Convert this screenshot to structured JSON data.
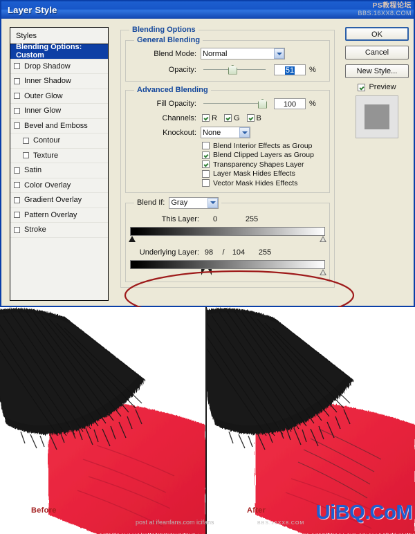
{
  "window": {
    "title": "Layer Style",
    "watermark_line1": "PS教程论坛",
    "watermark_line2": "BBS.16XX8.COM"
  },
  "sidebar": {
    "header": "Styles",
    "items": [
      {
        "label": "Blending Options: Custom",
        "selected": true,
        "checkbox": false,
        "indent": false
      },
      {
        "label": "Drop Shadow",
        "selected": false,
        "checkbox": true,
        "checked": false,
        "indent": false
      },
      {
        "label": "Inner Shadow",
        "selected": false,
        "checkbox": true,
        "checked": false,
        "indent": false
      },
      {
        "label": "Outer Glow",
        "selected": false,
        "checkbox": true,
        "checked": false,
        "indent": false
      },
      {
        "label": "Inner Glow",
        "selected": false,
        "checkbox": true,
        "checked": false,
        "indent": false
      },
      {
        "label": "Bevel and Emboss",
        "selected": false,
        "checkbox": true,
        "checked": false,
        "indent": false
      },
      {
        "label": "Contour",
        "selected": false,
        "checkbox": true,
        "checked": false,
        "indent": true
      },
      {
        "label": "Texture",
        "selected": false,
        "checkbox": true,
        "checked": false,
        "indent": true
      },
      {
        "label": "Satin",
        "selected": false,
        "checkbox": true,
        "checked": false,
        "indent": false
      },
      {
        "label": "Color Overlay",
        "selected": false,
        "checkbox": true,
        "checked": false,
        "indent": false
      },
      {
        "label": "Gradient Overlay",
        "selected": false,
        "checkbox": true,
        "checked": false,
        "indent": false
      },
      {
        "label": "Pattern Overlay",
        "selected": false,
        "checkbox": true,
        "checked": false,
        "indent": false
      },
      {
        "label": "Stroke",
        "selected": false,
        "checkbox": true,
        "checked": false,
        "indent": false
      }
    ]
  },
  "blending_options": {
    "title": "Blending Options",
    "general": {
      "title": "General Blending",
      "blend_mode_label": "Blend Mode:",
      "blend_mode_value": "Normal",
      "opacity_label": "Opacity:",
      "opacity_value": "51",
      "opacity_unit": "%",
      "opacity_percent": 51
    },
    "advanced": {
      "title": "Advanced Blending",
      "fill_opacity_label": "Fill Opacity:",
      "fill_opacity_value": "100",
      "fill_opacity_unit": "%",
      "fill_opacity_percent": 100,
      "channels_label": "Channels:",
      "channels": [
        {
          "label": "R",
          "checked": true
        },
        {
          "label": "G",
          "checked": true
        },
        {
          "label": "B",
          "checked": true
        }
      ],
      "knockout_label": "Knockout:",
      "knockout_value": "None",
      "options": [
        {
          "label": "Blend Interior Effects as Group",
          "checked": false
        },
        {
          "label": "Blend Clipped Layers as Group",
          "checked": true
        },
        {
          "label": "Transparency Shapes Layer",
          "checked": true
        },
        {
          "label": "Layer Mask Hides Effects",
          "checked": false
        },
        {
          "label": "Vector Mask Hides Effects",
          "checked": false
        }
      ]
    },
    "blend_if": {
      "label": "Blend If:",
      "channel_value": "Gray",
      "this_layer": {
        "label": "This Layer:",
        "black_value": "0",
        "white_value": "255"
      },
      "underlying_layer": {
        "label": "Underlying Layer:",
        "black_value": "98",
        "separator": "/",
        "black_value2": "104",
        "white_value": "255"
      }
    }
  },
  "buttons": {
    "ok": "OK",
    "cancel": "Cancel",
    "new_style": "New Style...",
    "preview_label": "Preview",
    "preview_checked": true
  },
  "comparison": {
    "before_caption": "Before",
    "after_caption": "After",
    "watermark_main": "UiBQ.CoM",
    "watermark_small": "post at ifeanfans.com  icifans",
    "watermark_small2": "BBS.16XX8.COM"
  },
  "colors": {
    "title_bar": "#1756c8",
    "dialog_face": "#ece9d8",
    "selection_blue": "#0d3fa5",
    "group_title": "#15489c",
    "annotation_red": "#9e1b1b",
    "caption_red": "#a32020",
    "paint_red": "#e8283f",
    "bristle_black": "#151515",
    "watermark_blue": "#1f5fd0"
  }
}
